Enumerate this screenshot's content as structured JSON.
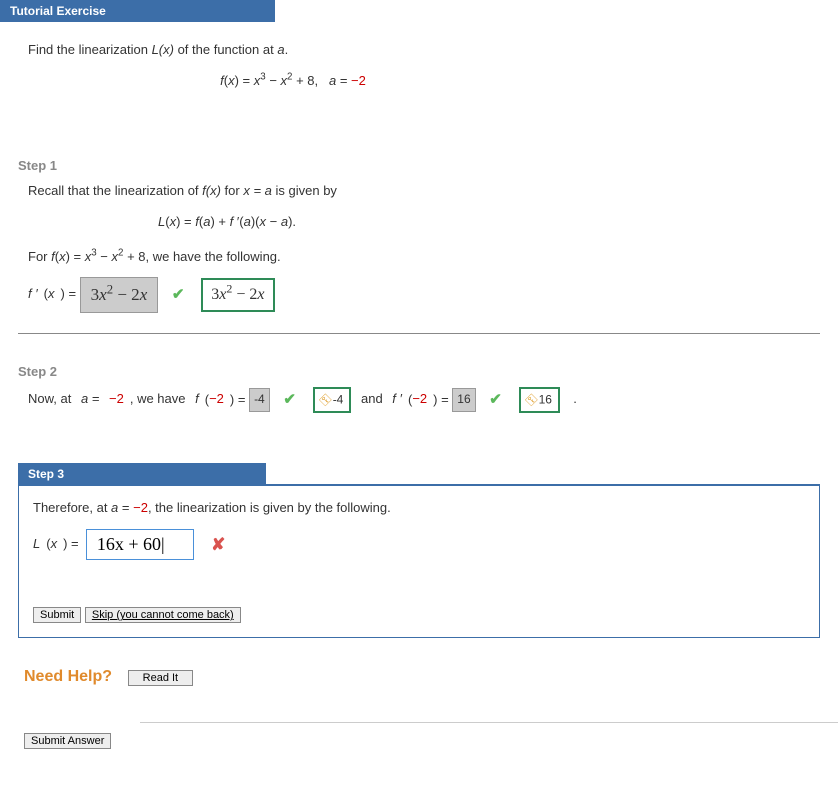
{
  "header": {
    "title": "Tutorial Exercise"
  },
  "problem": {
    "line1_pre": "Find the linearization ",
    "line1_Lx": "L(x)",
    "line1_mid": " of the function at ",
    "line1_a": "a",
    "line1_end": "."
  },
  "step1": {
    "label": "Step 1",
    "recall_pre": "Recall that the linearization of ",
    "recall_fx": "f(x)",
    "recall_mid": " for ",
    "recall_xa": "x = a",
    "recall_end": " is given by",
    "for_pre": "For ",
    "for_end": ", we have the following.",
    "fprime_label": "f ′(x) = ",
    "answer_locked": "3x² − 2x",
    "answer_correct": "3x² − 2x"
  },
  "step2": {
    "label": "Step 2",
    "now_pre": "Now, at ",
    "a_eq": "a = ",
    "a_val": "−2",
    "we_have": ", we have ",
    "f_of": "f(",
    "val_neg2": "−2",
    "close_eq": ") = ",
    "f_ans": "-4",
    "f_key": "-4",
    "and": " and ",
    "fprime_of": "f ′(",
    "fp_ans": "16",
    "fp_key": "16",
    "period": "."
  },
  "step3": {
    "label": "Step 3",
    "therefore_pre": "Therefore, at ",
    "therefore_end": ", the linearization is given by the following.",
    "Lx_eq": "L(x) =  ",
    "input_value": "16x + 60|",
    "submit": "Submit",
    "skip": "Skip (you cannot come back)"
  },
  "help": {
    "label": "Need Help?",
    "read": "Read It"
  },
  "footer": {
    "submit": "Submit Answer"
  }
}
